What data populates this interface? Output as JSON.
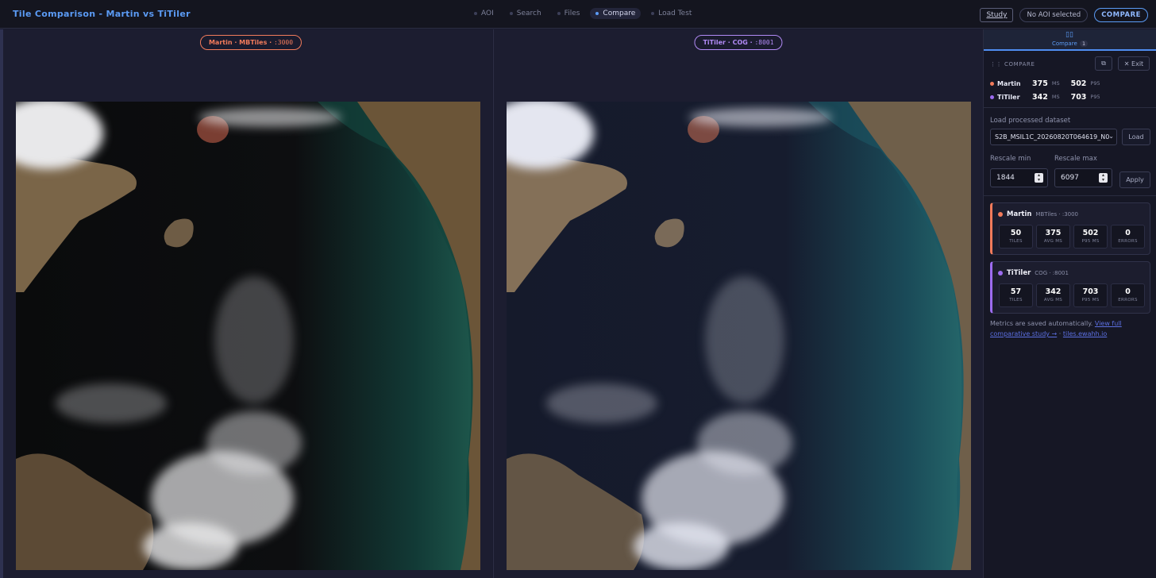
{
  "header": {
    "title": "Tile Comparison - Martin vs TiTiler",
    "nav": [
      {
        "label": "AOI",
        "active": false
      },
      {
        "label": "Search",
        "active": false
      },
      {
        "label": "Files",
        "active": false
      },
      {
        "label": "Compare",
        "active": true
      },
      {
        "label": "Load Test",
        "active": false
      }
    ],
    "study_button": "Study",
    "aoi_status": "No AOI selected",
    "compare_button": "COMPARE"
  },
  "panes": {
    "left": {
      "name": "Martin · MBTiles ·",
      "port": ":3000"
    },
    "right": {
      "name": "TiTiler · COG ·",
      "port": ":8001"
    }
  },
  "sidebar": {
    "tab": {
      "label": "Compare",
      "count": "1",
      "icon": "compare-icon"
    },
    "section_title": "COMPARE",
    "copy_icon": "⧉",
    "exit_label": "✕ Exit",
    "summary": [
      {
        "name": "Martin",
        "ms": "375",
        "ms_unit": "MS",
        "p95": "502",
        "p95_unit": "P95",
        "color": "#f27b5b"
      },
      {
        "name": "TiTiler",
        "ms": "342",
        "ms_unit": "MS",
        "p95": "703",
        "p95_unit": "P95",
        "color": "#9d6cf0"
      }
    ],
    "dataset_label": "Load processed dataset",
    "dataset_value": "S2B_MSIL1C_20260820T064619_N0",
    "load_button": "Load",
    "rescale_min_label": "Rescale min",
    "rescale_min": "1844",
    "rescale_max_label": "Rescale max",
    "rescale_max": "6097",
    "apply_button": "Apply",
    "cards": [
      {
        "name": "Martin",
        "sub": "MBTiles · :3000",
        "color": "#f27b5b",
        "stats": [
          {
            "v": "50",
            "l": "TILES"
          },
          {
            "v": "375",
            "l": "AVG MS"
          },
          {
            "v": "502",
            "l": "P95 MS"
          },
          {
            "v": "0",
            "l": "ERRORS"
          }
        ]
      },
      {
        "name": "TiTiler",
        "sub": "COG · :8001",
        "color": "#9d6cf0",
        "stats": [
          {
            "v": "57",
            "l": "TILES"
          },
          {
            "v": "342",
            "l": "AVG MS"
          },
          {
            "v": "703",
            "l": "P95 MS"
          },
          {
            "v": "0",
            "l": "ERRORS"
          }
        ]
      }
    ],
    "footer_text": "Metrics are saved automatically.",
    "footer_link1": "View full comparative study →",
    "footer_sep": " · ",
    "footer_link2": "tiles.ewahh.io"
  }
}
